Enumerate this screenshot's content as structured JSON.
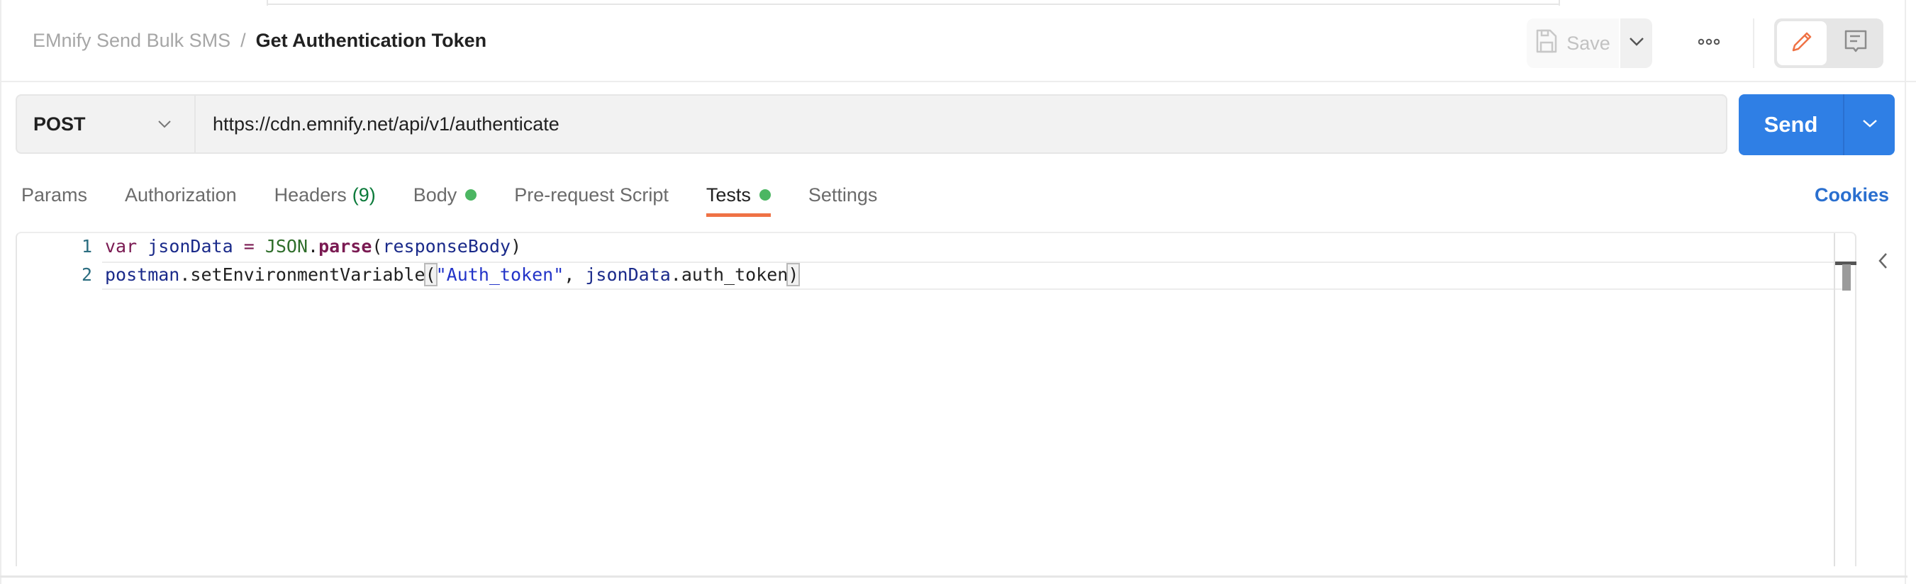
{
  "breadcrumb": {
    "collection": "EMnify Send Bulk SMS",
    "separator": "/",
    "request": "Get Authentication Token"
  },
  "header": {
    "save_label": "Save",
    "icons": {
      "save": "floppy-disk-icon",
      "save_caret": "chevron-down-icon",
      "more": "more-horizontal-icon",
      "edit_mode": "pencil-icon",
      "comment_mode": "comment-icon"
    }
  },
  "request": {
    "method": "POST",
    "url": "https://cdn.emnify.net/api/v1/authenticate",
    "send_label": "Send"
  },
  "tabs": [
    {
      "label": "Params"
    },
    {
      "label": "Authorization"
    },
    {
      "label": "Headers",
      "count": "(9)"
    },
    {
      "label": "Body",
      "has_indicator": true
    },
    {
      "label": "Pre-request Script"
    },
    {
      "label": "Tests",
      "has_indicator": true,
      "active": true
    },
    {
      "label": "Settings"
    }
  ],
  "cookies_label": "Cookies",
  "colors": {
    "accent_orange": "#ef7245",
    "send_blue": "#2f7fe5",
    "link_blue": "#2a6fcf",
    "indicator_green": "#4cb662"
  },
  "editor": {
    "lines": [
      {
        "number": "1",
        "tokens": [
          {
            "t": "var",
            "c": "kw"
          },
          {
            "t": " ",
            "c": "plain"
          },
          {
            "t": "jsonData",
            "c": "var"
          },
          {
            "t": " ",
            "c": "plain"
          },
          {
            "t": "=",
            "c": "kw"
          },
          {
            "t": " ",
            "c": "plain"
          },
          {
            "t": "JSON",
            "c": "cls"
          },
          {
            "t": ".",
            "c": "plain"
          },
          {
            "t": "parse",
            "c": "fn"
          },
          {
            "t": "(",
            "c": "plain"
          },
          {
            "t": "responseBody",
            "c": "var"
          },
          {
            "t": ")",
            "c": "plain"
          }
        ]
      },
      {
        "number": "2",
        "tokens": [
          {
            "t": "postman",
            "c": "var"
          },
          {
            "t": ".",
            "c": "plain"
          },
          {
            "t": "setEnvironmentVariable",
            "c": "plain"
          },
          {
            "t": "(",
            "c": "plain bracket-hl"
          },
          {
            "t": "\"Auth_token\"",
            "c": "str"
          },
          {
            "t": ", ",
            "c": "plain"
          },
          {
            "t": "jsonData",
            "c": "var"
          },
          {
            "t": ".",
            "c": "plain"
          },
          {
            "t": "auth_token",
            "c": "plain"
          },
          {
            "t": ")",
            "c": "plain bracket-hl"
          }
        ]
      }
    ]
  }
}
